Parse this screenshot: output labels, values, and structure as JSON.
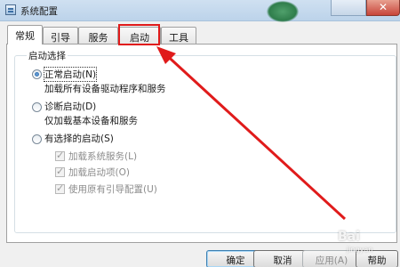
{
  "window": {
    "title": "系统配置"
  },
  "tabs": [
    "常规",
    "引导",
    "服务",
    "启动",
    "工具"
  ],
  "active_tab": "常规",
  "highlighted_tab": "启动",
  "group": {
    "legend": "启动选择",
    "options": [
      {
        "label": "正常启动(N)",
        "desc": "加载所有设备驱动程序和服务",
        "checked": true
      },
      {
        "label": "诊断启动(D)",
        "desc": "仅加载基本设备和服务",
        "checked": false
      },
      {
        "label": "有选择的启动(S)",
        "desc": "",
        "checked": false
      }
    ],
    "selective_items": [
      {
        "label": "加载系统服务(L)",
        "checked": true,
        "enabled": false
      },
      {
        "label": "加载启动项(O)",
        "checked": true,
        "enabled": false
      },
      {
        "label": "使用原有引导配置(U)",
        "checked": true,
        "enabled": false
      }
    ]
  },
  "buttons": {
    "ok": "确定",
    "cancel": "取消",
    "apply": "应用(A)",
    "help": "帮助"
  },
  "annotation": {
    "highlight_color": "#e01b1b",
    "arrow_color": "#e01b1b"
  },
  "watermark": {
    "brand": "Bai",
    "sub": "jingyan"
  }
}
